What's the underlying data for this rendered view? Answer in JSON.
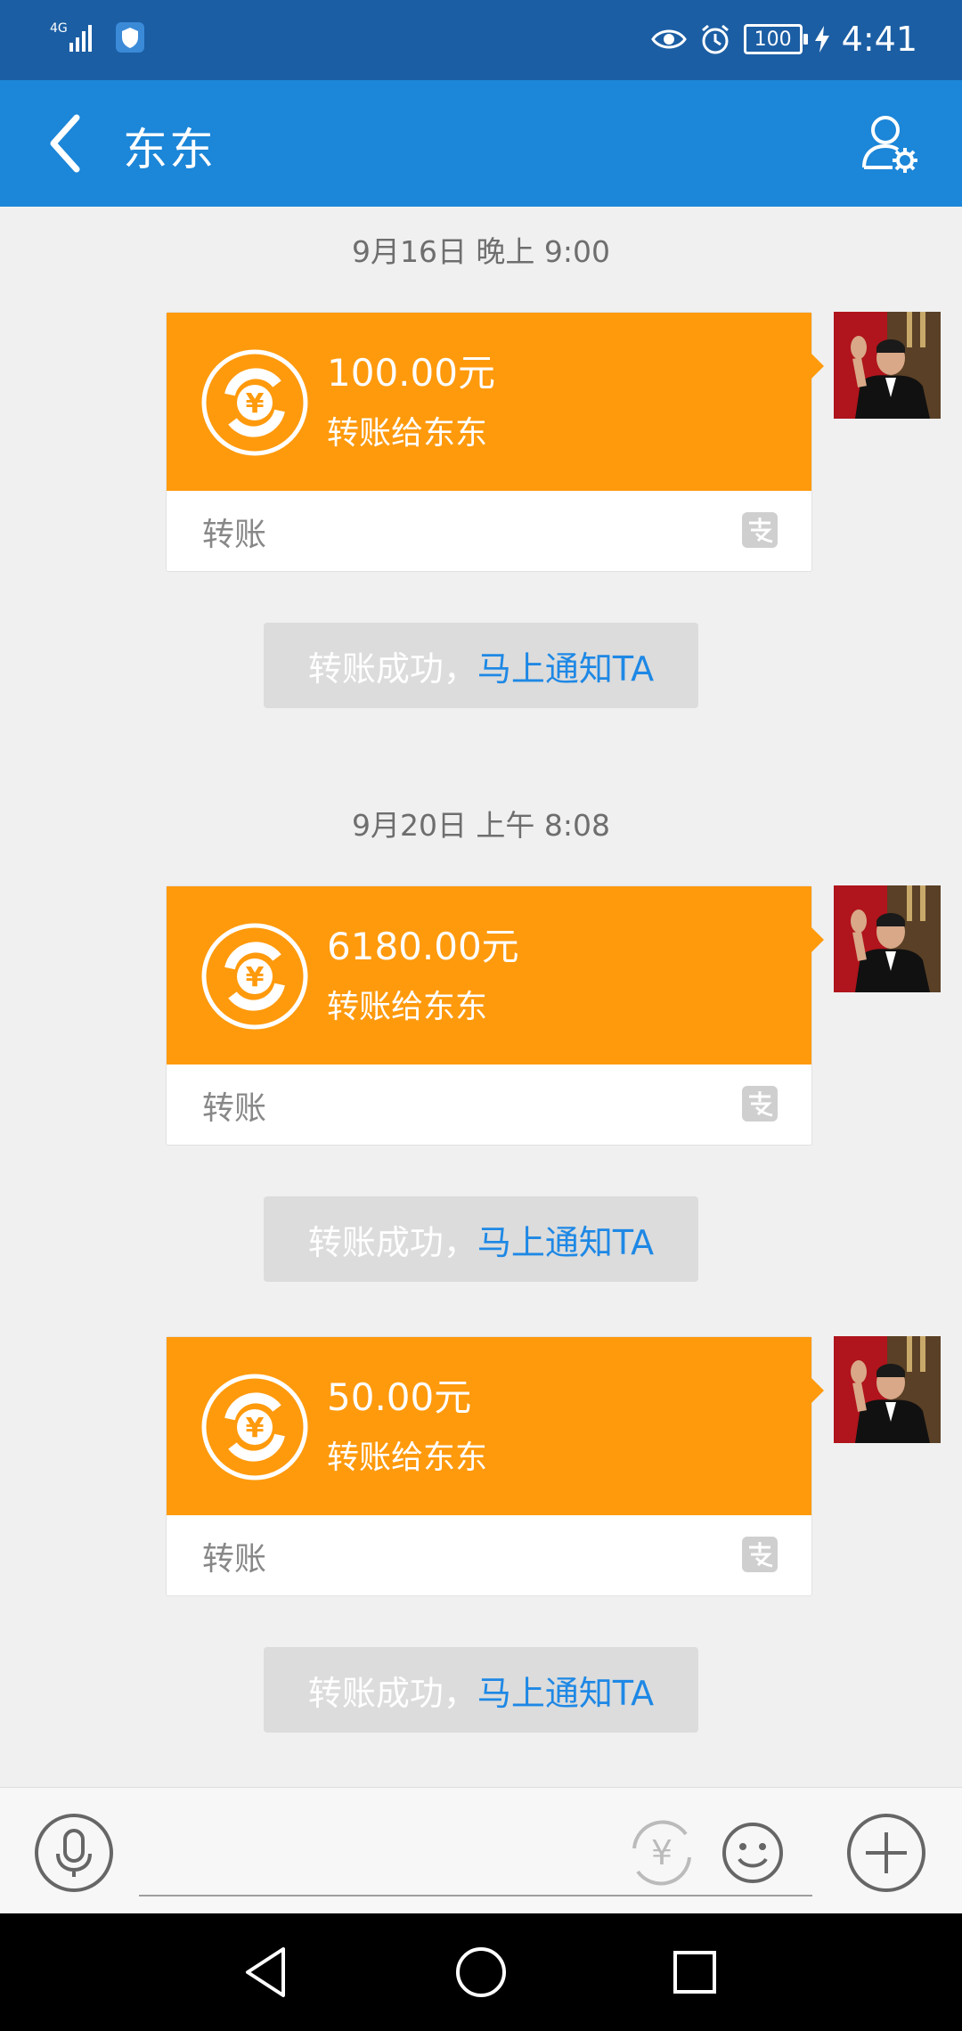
{
  "status_bar": {
    "network": "4G",
    "battery": "100",
    "time": "4:41"
  },
  "header": {
    "title": "东东"
  },
  "messages": [
    {
      "timestamp": "9月16日 晚上 9:00",
      "amount": "100.00元",
      "subtitle": "转账给东东",
      "label": "转账",
      "notice_prefix": "转账成功，",
      "notice_link": "马上通知TA"
    },
    {
      "timestamp": "9月20日 上午 8:08",
      "amount": "6180.00元",
      "subtitle": "转账给东东",
      "label": "转账",
      "notice_prefix": "转账成功，",
      "notice_link": "马上通知TA"
    },
    {
      "amount": "50.00元",
      "subtitle": "转账给东东",
      "label": "转账",
      "notice_prefix": "转账成功，",
      "notice_link": "马上通知TA"
    }
  ],
  "colors": {
    "status_bar": "#1b5ea4",
    "app_bar": "#1c86d8",
    "transfer_card": "#ff9a0d",
    "link": "#1e88e5"
  }
}
